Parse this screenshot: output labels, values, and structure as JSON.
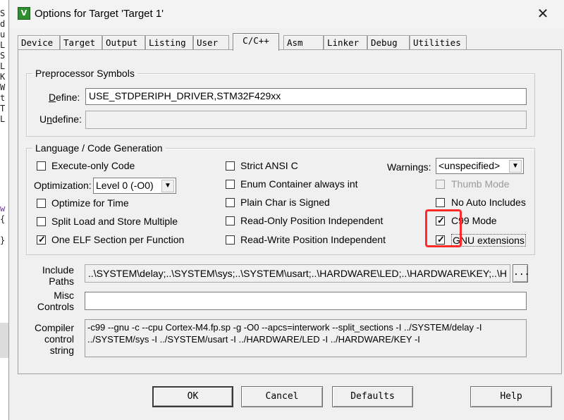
{
  "background_editor": {
    "lines": [
      "S",
      "d",
      "u",
      "L",
      "S",
      "L",
      "K",
      "W",
      "t",
      "T",
      "L"
    ],
    "bottom_glyphs": [
      "w",
      "{",
      "}"
    ]
  },
  "window": {
    "title": "Options for Target 'Target 1'",
    "close_glyph": "✕",
    "icon_glyph": "V"
  },
  "tabs": [
    {
      "label": "Device"
    },
    {
      "label": "Target"
    },
    {
      "label": "Output"
    },
    {
      "label": "Listing"
    },
    {
      "label": "User"
    },
    {
      "label": "C/C++",
      "active": true
    },
    {
      "label": "Asm"
    },
    {
      "label": "Linker"
    },
    {
      "label": "Debug"
    },
    {
      "label": "Utilities"
    }
  ],
  "preprocessor": {
    "legend": "Preprocessor Symbols",
    "define_label": "Define:",
    "define_value": "USE_STDPERIPH_DRIVER,STM32F429xx",
    "undefine_label": "Undefine:",
    "undefine_value": ""
  },
  "codegen": {
    "legend": "Language / Code Generation",
    "execute_only": {
      "label": "Execute-only Code",
      "checked": false
    },
    "optimization_label": "Optimization:",
    "optimization_value": "Level 0 (-O0)",
    "optimize_time": {
      "label": "Optimize for Time",
      "checked": false
    },
    "split_load": {
      "label": "Split Load and Store Multiple",
      "checked": false
    },
    "one_elf": {
      "label": "One ELF Section per Function",
      "checked": true
    },
    "strict_ansi": {
      "label": "Strict ANSI C",
      "checked": false
    },
    "enum_container": {
      "label": "Enum Container always int",
      "checked": false
    },
    "plain_char": {
      "label": "Plain Char is Signed",
      "checked": false
    },
    "ro_pi": {
      "label": "Read-Only Position Independent",
      "checked": false
    },
    "rw_pi": {
      "label": "Read-Write Position Independent",
      "checked": false
    },
    "warnings_label": "Warnings:",
    "warnings_value": "<unspecified>",
    "thumb_mode": {
      "label": "Thumb Mode",
      "checked": false,
      "disabled": true
    },
    "no_auto_includes": {
      "label": "No Auto Includes",
      "checked": false
    },
    "c99_mode": {
      "label": "C99 Mode",
      "checked": true
    },
    "gnu_extensions": {
      "label": "GNU extensions",
      "checked": true
    }
  },
  "paths": {
    "include_label_1": "Include",
    "include_label_2": "Paths",
    "include_value": "..\\SYSTEM\\delay;..\\SYSTEM\\sys;..\\SYSTEM\\usart;..\\HARDWARE\\LED;..\\HARDWARE\\KEY;..\\H",
    "browse_label": "...",
    "misc_label_1": "Misc",
    "misc_label_2": "Controls",
    "misc_value": "",
    "compiler_label_1": "Compiler",
    "compiler_label_2": "control",
    "compiler_label_3": "string",
    "compiler_value": "-c99 --gnu -c --cpu Cortex-M4.fp.sp -g -O0 --apcs=interwork --split_sections -I ../SYSTEM/delay -I ../SYSTEM/sys -I ../SYSTEM/usart -I ../HARDWARE/LED -I ../HARDWARE/KEY -I"
  },
  "buttons": {
    "ok": "OK",
    "cancel": "Cancel",
    "defaults": "Defaults",
    "help": "Help"
  },
  "colors": {
    "highlight": "#ff2a2a",
    "dialog_bg": "#f0f0f0"
  }
}
